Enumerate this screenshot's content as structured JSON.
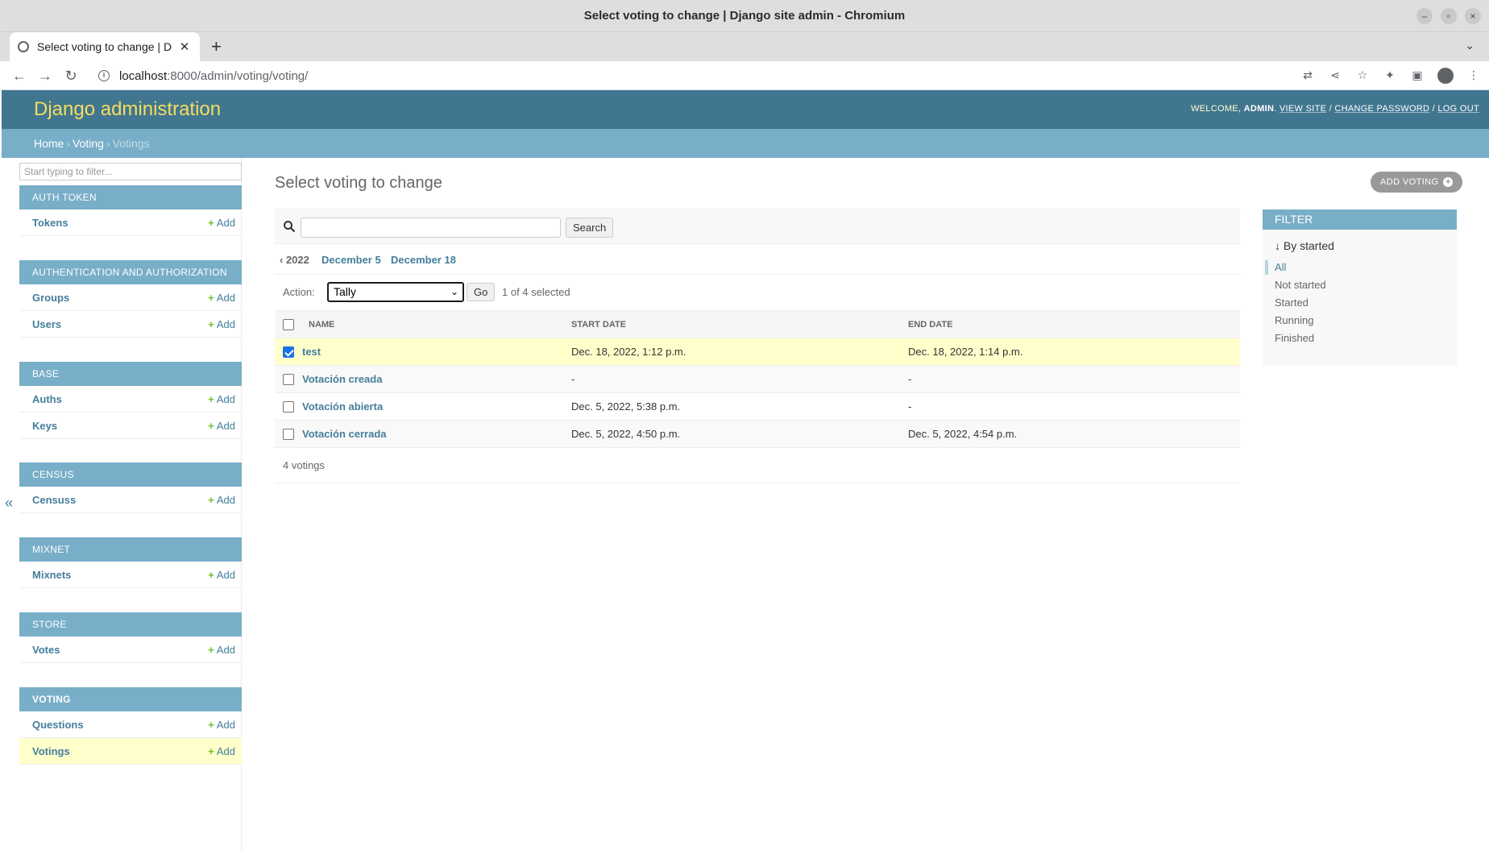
{
  "window": {
    "title": "Select voting to change | Django site admin - Chromium"
  },
  "browser": {
    "tab_title": "Select voting to change | D",
    "url_host": "localhost",
    "url_rest": ":8000/admin/voting/voting/"
  },
  "admin": {
    "brand": "Django administration",
    "welcome": "WELCOME,",
    "user": "ADMIN",
    "view_site": "VIEW SITE",
    "change_password": "CHANGE PASSWORD",
    "log_out": "LOG OUT"
  },
  "breadcrumbs": {
    "home": "Home",
    "app": "Voting",
    "current": "Votings"
  },
  "sidebar": {
    "filter_placeholder": "Start typing to filter...",
    "add_label": "Add",
    "modules": [
      {
        "caption": "AUTH TOKEN",
        "models": [
          "Tokens"
        ]
      },
      {
        "caption": "AUTHENTICATION AND AUTHORIZATION",
        "models": [
          "Groups",
          "Users"
        ]
      },
      {
        "caption": "BASE",
        "models": [
          "Auths",
          "Keys"
        ]
      },
      {
        "caption": "CENSUS",
        "models": [
          "Censuss"
        ]
      },
      {
        "caption": "MIXNET",
        "models": [
          "Mixnets"
        ]
      },
      {
        "caption": "STORE",
        "models": [
          "Votes"
        ]
      },
      {
        "caption": "VOTING",
        "models": [
          "Questions",
          "Votings"
        ]
      }
    ],
    "collapse": "«"
  },
  "content": {
    "title": "Select voting to change",
    "add_button": "ADD VOTING",
    "search_button": "Search",
    "date_hierarchy": {
      "back": "‹ 2022",
      "d1": "December 5",
      "d2": "December 18"
    },
    "action_label": "Action:",
    "action_value": "Tally",
    "go_button": "Go",
    "selected_count": "1 of 4 selected",
    "columns": {
      "name": "NAME",
      "start": "START DATE",
      "end": "END DATE"
    },
    "rows": [
      {
        "name": "test",
        "start": "Dec. 18, 2022, 1:12 p.m.",
        "end": "Dec. 18, 2022, 1:14 p.m.",
        "checked": true
      },
      {
        "name": "Votación creada",
        "start": "-",
        "end": "-",
        "checked": false
      },
      {
        "name": "Votación abierta",
        "start": "Dec. 5, 2022, 5:38 p.m.",
        "end": "-",
        "checked": false
      },
      {
        "name": "Votación cerrada",
        "start": "Dec. 5, 2022, 4:50 p.m.",
        "end": "Dec. 5, 2022, 4:54 p.m.",
        "checked": false
      }
    ],
    "paginator": "4 votings"
  },
  "filter": {
    "heading": "FILTER",
    "by": "↓ By started",
    "options": [
      "All",
      "Not started",
      "Started",
      "Running",
      "Finished"
    ],
    "selected": "All"
  }
}
